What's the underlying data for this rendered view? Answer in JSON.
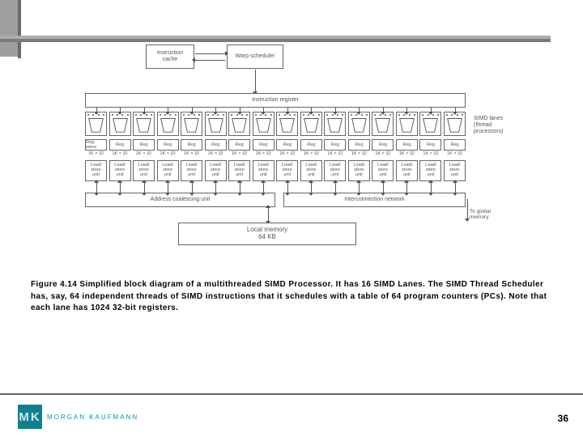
{
  "header": {},
  "diagram": {
    "instr_cache": "Instruction\ncache",
    "warp_scheduler": "Warp scheduler",
    "instr_register": "Instruction register",
    "lane_reg_label": "Reg",
    "lane_reg0_label": "Reg-\nisters",
    "lane_regsize": "1K × 32",
    "lane_ldst": "Load/\nstore\nunit",
    "addr_coalesce": "Address coalescing unit",
    "interconnect": "Interconnection network",
    "local_mem": "Local memory\n64 KB",
    "side_lanes": "SIMD lanes\n(thread\nprocessors)",
    "side_global": "To global\nmemory",
    "num_lanes": 16
  },
  "caption": "Figure 4.14 Simplified block diagram of a multithreaded SIMD Processor. It has 16 SIMD Lanes. The SIMD Thread Scheduler has, say, 64 independent threads of SIMD instructions that it schedules with a table of 64 program counters (PCs). Note that each lane has 1024 32-bit registers.",
  "footer": {
    "publisher_mark": "MK",
    "publisher_name": "MORGAN KAUFMANN",
    "page_number": "36"
  }
}
